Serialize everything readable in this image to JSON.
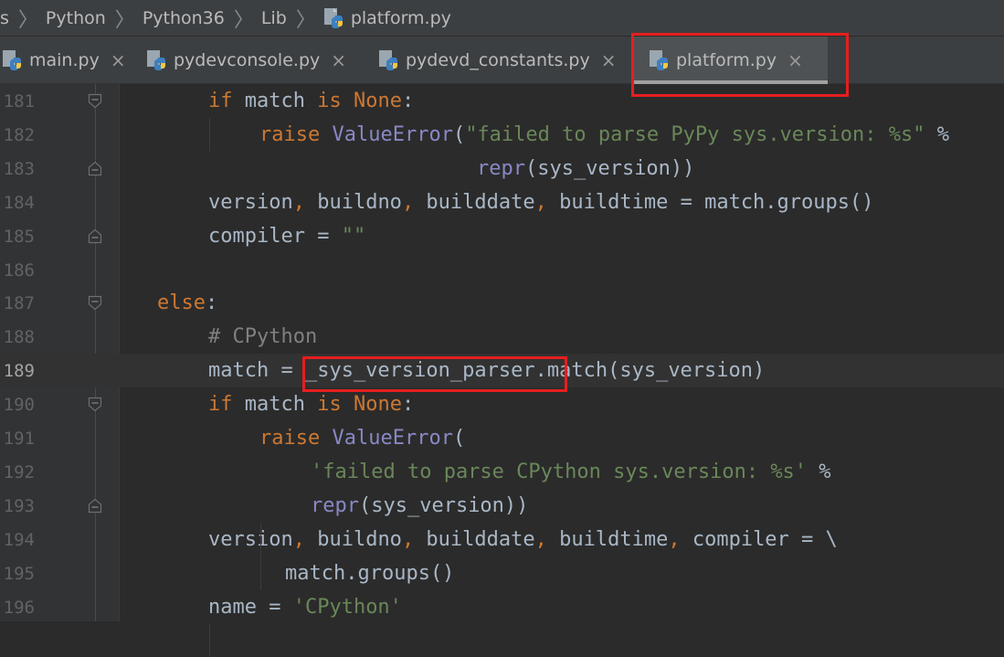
{
  "breadcrumb": {
    "items": [
      "s",
      "Python",
      "Python36",
      "Lib",
      "platform.py"
    ]
  },
  "tabs": [
    {
      "label": "main.py",
      "active": false
    },
    {
      "label": "pydevconsole.py",
      "active": false
    },
    {
      "label": "pydevd_constants.py",
      "active": false
    },
    {
      "label": "platform.py",
      "active": true
    }
  ],
  "close_glyph": "×",
  "editor": {
    "current_line": 189,
    "lines": [
      {
        "num": "181",
        "tokens": [
          [
            "kw",
            "if"
          ],
          [
            "t",
            " match "
          ],
          [
            "kw",
            "is"
          ],
          [
            "t",
            " "
          ],
          [
            "kw",
            "None"
          ],
          [
            "t",
            ":"
          ]
        ]
      },
      {
        "num": "182",
        "tokens": [
          [
            "kw",
            "raise"
          ],
          [
            "t",
            " "
          ],
          [
            "bi",
            "ValueError"
          ],
          [
            "t",
            "("
          ],
          [
            "str",
            "\"failed to parse PyPy sys.version: %s\""
          ],
          [
            "t",
            " %"
          ]
        ]
      },
      {
        "num": "183",
        "tokens": [
          [
            "bi",
            "repr"
          ],
          [
            "t",
            "(sys_version))"
          ]
        ]
      },
      {
        "num": "184",
        "tokens": [
          [
            "t",
            "version"
          ],
          [
            "kw",
            ","
          ],
          [
            "t",
            " buildno"
          ],
          [
            "kw",
            ","
          ],
          [
            "t",
            " builddate"
          ],
          [
            "kw",
            ","
          ],
          [
            "t",
            " buildtime = match.groups()"
          ]
        ]
      },
      {
        "num": "185",
        "tokens": [
          [
            "t",
            "compiler = "
          ],
          [
            "str",
            "\"\""
          ]
        ]
      },
      {
        "num": "186",
        "tokens": []
      },
      {
        "num": "187",
        "tokens": [
          [
            "kw",
            "else"
          ],
          [
            "t",
            ":"
          ]
        ]
      },
      {
        "num": "188",
        "tokens": [
          [
            "cm",
            "# CPython"
          ]
        ]
      },
      {
        "num": "189",
        "tokens": [
          [
            "t",
            "match = _sys_version_parser.match(sys_version)"
          ]
        ]
      },
      {
        "num": "190",
        "tokens": [
          [
            "kw",
            "if"
          ],
          [
            "t",
            " match "
          ],
          [
            "kw",
            "is"
          ],
          [
            "t",
            " "
          ],
          [
            "kw",
            "None"
          ],
          [
            "t",
            ":"
          ]
        ]
      },
      {
        "num": "191",
        "tokens": [
          [
            "kw",
            "raise"
          ],
          [
            "t",
            " "
          ],
          [
            "bi",
            "ValueError"
          ],
          [
            "t",
            "("
          ]
        ]
      },
      {
        "num": "192",
        "tokens": [
          [
            "str",
            "'failed to parse CPython sys.version: %s'"
          ],
          [
            "t",
            " %"
          ]
        ]
      },
      {
        "num": "193",
        "tokens": [
          [
            "bi",
            "repr"
          ],
          [
            "t",
            "(sys_version))"
          ]
        ]
      },
      {
        "num": "194",
        "tokens": [
          [
            "t",
            "version"
          ],
          [
            "kw",
            ","
          ],
          [
            "t",
            " buildno"
          ],
          [
            "kw",
            ","
          ],
          [
            "t",
            " builddate"
          ],
          [
            "kw",
            ","
          ],
          [
            "t",
            " buildtime"
          ],
          [
            "kw",
            ","
          ],
          [
            "t",
            " compiler = \\"
          ]
        ]
      },
      {
        "num": "195",
        "tokens": [
          [
            "t",
            "match.groups()"
          ]
        ]
      },
      {
        "num": "196",
        "tokens": [
          [
            "t",
            "name = "
          ],
          [
            "str",
            "'CPython'"
          ]
        ]
      }
    ]
  },
  "highlights": [
    "platform.py tab",
    "_sys_version_parser"
  ],
  "colors": {
    "keyword": "#cc7832",
    "builtin": "#8888c6",
    "string": "#6a8759",
    "comment": "#808080",
    "text": "#a9b7c6",
    "highlight_box": "#e61e1e"
  }
}
